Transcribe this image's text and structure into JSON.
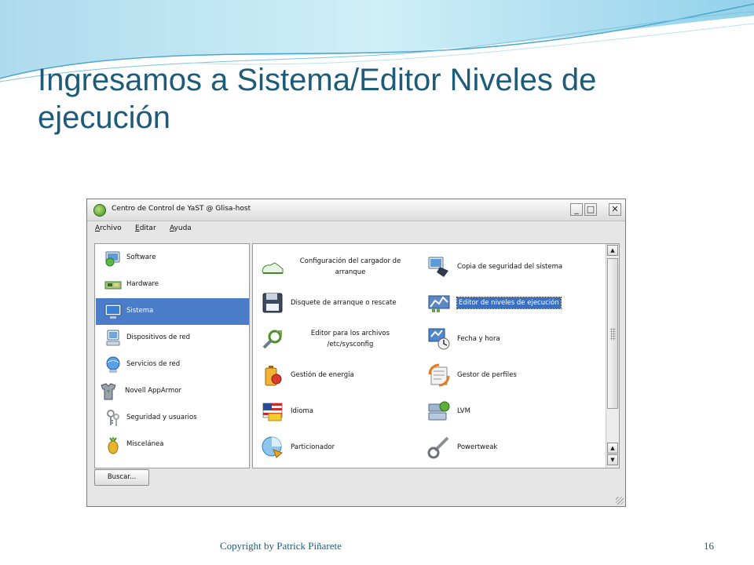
{
  "slide": {
    "title_line1": "Ingresamos a Sistema/Editor Niveles de",
    "title_line2": "ejecución",
    "footer": "Copyright by Patrick Piñarete",
    "page_number": "16"
  },
  "window": {
    "title": "Centro de Control de YaST @ Glisa-host",
    "minimize_glyph": "_",
    "maximize_glyph": "□",
    "close_glyph": "✕",
    "menu": [
      {
        "accel": "A",
        "rest": "rchivo"
      },
      {
        "accel": "E",
        "rest": "ditar"
      },
      {
        "accel": "A",
        "rest": "yuda"
      }
    ]
  },
  "categories": [
    {
      "label": "Software",
      "icon": "software-icon",
      "selected": false
    },
    {
      "label": "Hardware",
      "icon": "hardware-icon",
      "selected": false
    },
    {
      "label": "Sistema",
      "icon": "system-monitor-icon",
      "selected": true
    },
    {
      "label": "Dispositivos de red",
      "icon": "network-devices-icon",
      "selected": false
    },
    {
      "label": "Servicios de red",
      "icon": "network-services-icon",
      "selected": false
    },
    {
      "label": "Novell AppArmor",
      "icon": "apparmor-icon",
      "selected": false
    },
    {
      "label": "Seguridad y usuarios",
      "icon": "users-keys-icon",
      "selected": false
    },
    {
      "label": "Miscelánea",
      "icon": "pineapple-icon",
      "selected": false
    }
  ],
  "modules_left": [
    {
      "label_line1": "Configuración del cargador de",
      "label_line2": "arranque",
      "icon": "boot-loader-shoe-icon"
    },
    {
      "label_line1": "Disquete de arranque o rescate",
      "label_line2": "",
      "icon": "floppy-disk-icon"
    },
    {
      "label_line1": "Editor para los archivos",
      "label_line2": "/etc/sysconfig",
      "icon": "sysconfig-editor-icon"
    },
    {
      "label_line1": "Gestión de energía",
      "label_line2": "",
      "icon": "power-battery-icon"
    },
    {
      "label_line1": "Idioma",
      "label_line2": "",
      "icon": "language-flag-icon"
    },
    {
      "label_line1": "Particionador",
      "label_line2": "",
      "icon": "partitioner-disk-icon"
    }
  ],
  "modules_right": [
    {
      "label": "Copia de seguridad del sistema",
      "icon": "backup-icon",
      "selected": false
    },
    {
      "label": "Editor de niveles de ejecución",
      "icon": "runlevel-editor-icon",
      "selected": true
    },
    {
      "label": "Fecha y hora",
      "icon": "date-time-icon",
      "selected": false
    },
    {
      "label": "Gestor de perfiles",
      "icon": "profile-manager-icon",
      "selected": false
    },
    {
      "label": "LVM",
      "icon": "lvm-icon",
      "selected": false
    },
    {
      "label": "Powertweak",
      "icon": "powertweak-icon",
      "selected": false
    }
  ],
  "search_button": "Buscar...",
  "colors": {
    "title": "#1d5b78",
    "selection": "#4a7cc7"
  }
}
